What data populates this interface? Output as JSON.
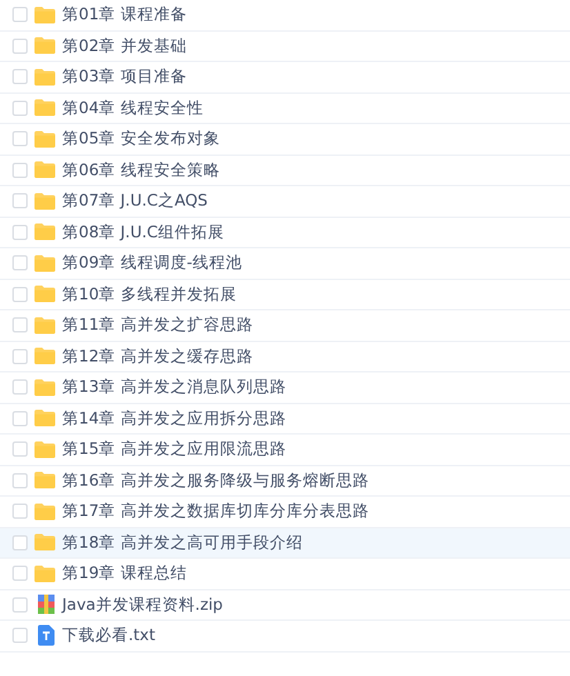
{
  "files": [
    {
      "kind": "folder",
      "name": "第01章 课程准备",
      "highlighted": false
    },
    {
      "kind": "folder",
      "name": "第02章 并发基础",
      "highlighted": false
    },
    {
      "kind": "folder",
      "name": "第03章 项目准备",
      "highlighted": false
    },
    {
      "kind": "folder",
      "name": "第04章 线程安全性",
      "highlighted": false
    },
    {
      "kind": "folder",
      "name": "第05章 安全发布对象",
      "highlighted": false
    },
    {
      "kind": "folder",
      "name": "第06章 线程安全策略",
      "highlighted": false
    },
    {
      "kind": "folder",
      "name": "第07章 J.U.C之AQS",
      "highlighted": false
    },
    {
      "kind": "folder",
      "name": "第08章 J.U.C组件拓展",
      "highlighted": false
    },
    {
      "kind": "folder",
      "name": "第09章 线程调度-线程池",
      "highlighted": false
    },
    {
      "kind": "folder",
      "name": "第10章 多线程并发拓展",
      "highlighted": false
    },
    {
      "kind": "folder",
      "name": "第11章 高并发之扩容思路",
      "highlighted": false
    },
    {
      "kind": "folder",
      "name": "第12章 高并发之缓存思路",
      "highlighted": false
    },
    {
      "kind": "folder",
      "name": "第13章 高并发之消息队列思路",
      "highlighted": false
    },
    {
      "kind": "folder",
      "name": "第14章 高并发之应用拆分思路",
      "highlighted": false
    },
    {
      "kind": "folder",
      "name": "第15章 高并发之应用限流思路",
      "highlighted": false
    },
    {
      "kind": "folder",
      "name": "第16章 高并发之服务降级与服务熔断思路",
      "highlighted": false
    },
    {
      "kind": "folder",
      "name": "第17章 高并发之数据库切库分库分表思路",
      "highlighted": false
    },
    {
      "kind": "folder",
      "name": "第18章 高并发之高可用手段介绍",
      "highlighted": true
    },
    {
      "kind": "folder",
      "name": "第19章 课程总结",
      "highlighted": false
    },
    {
      "kind": "zip",
      "name": "Java并发课程资料.zip",
      "highlighted": false
    },
    {
      "kind": "txt",
      "name": "下载必看.txt",
      "highlighted": false
    }
  ]
}
